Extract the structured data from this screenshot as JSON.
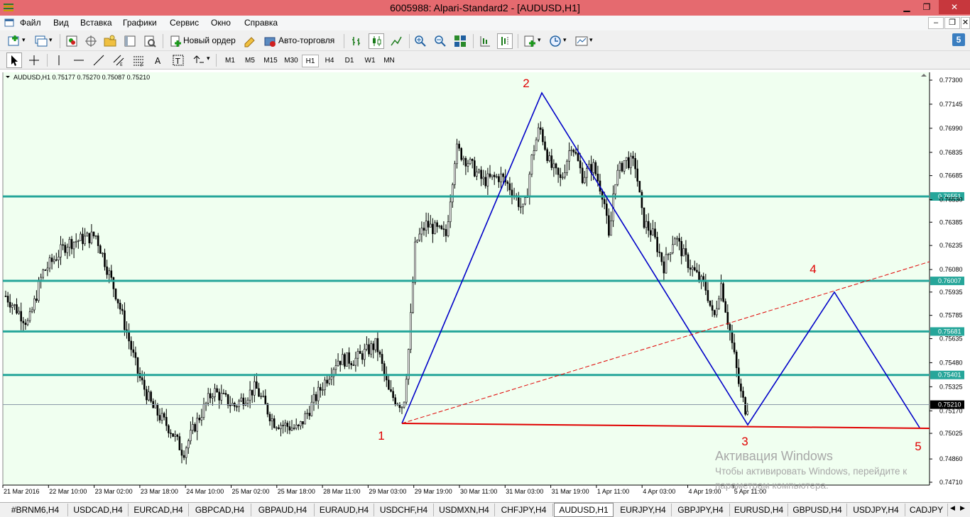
{
  "window": {
    "title": "6005988: Alpari-Standard2 - [AUDUSD,H1]",
    "minimize": "▁",
    "restore": "❐",
    "close": "✕"
  },
  "menu": {
    "items": [
      "Файл",
      "Вид",
      "Вставка",
      "Графики",
      "Сервис",
      "Окно",
      "Справка"
    ]
  },
  "toolbar": {
    "new_order": "Новый ордер",
    "auto_trading": "Авто-торговля"
  },
  "timeframes": [
    "M1",
    "M5",
    "M15",
    "M30",
    "H1",
    "H4",
    "D1",
    "W1",
    "MN"
  ],
  "active_timeframe": "H1",
  "chart": {
    "info": "AUDUSD,H1  0.75177 0.75270 0.75087 0.75210",
    "price_labels": [
      "0.77300",
      "0.77145",
      "0.76990",
      "0.76835",
      "0.76685",
      "0.76530",
      "0.76385",
      "0.76235",
      "0.76080",
      "0.75935",
      "0.75785",
      "0.75635",
      "0.75480",
      "0.75325",
      "0.75170",
      "0.75025",
      "0.74860",
      "0.74710"
    ],
    "level_labels": [
      "0.76551",
      "0.76007",
      "0.75681",
      "0.75401"
    ],
    "current_price": "0.75210",
    "time_labels": [
      "21 Mar 2016",
      "22 Mar 10:00",
      "23 Mar 02:00",
      "23 Mar 18:00",
      "24 Mar 10:00",
      "25 Mar 02:00",
      "25 Mar 18:00",
      "28 Mar 11:00",
      "29 Mar 03:00",
      "29 Mar 19:00",
      "30 Mar 11:00",
      "31 Mar 03:00",
      "31 Mar 19:00",
      "1 Apr 11:00",
      "4 Apr 03:00",
      "4 Apr 19:00",
      "5 Apr 11:00"
    ],
    "points": [
      "1",
      "2",
      "3",
      "4",
      "5"
    ],
    "colors": {
      "background": "#f0fff0",
      "levels": "#26a69a",
      "pattern": "#0000c8",
      "support": "#e00000",
      "labels": "#e00000",
      "candles": "#000000"
    }
  },
  "watermark": {
    "title": "Активация Windows",
    "line1": "Чтобы активировать Windows, перейдите к",
    "line2": "параметрам компьютера."
  },
  "tabs": [
    "#BRNM6,H4",
    "USDCAD,H4",
    "EURCAD,H4",
    "GBPCAD,H4",
    "GBPAUD,H4",
    "EURAUD,H4",
    "USDCHF,H4",
    "USDMXN,H4",
    "CHFJPY,H4",
    "AUDUSD,H1",
    "EURJPY,H4",
    "GBPJPY,H4",
    "EURUSD,H4",
    "GBPUSD,H4",
    "USDJPY,H4",
    "CADJPY"
  ],
  "active_tab": "AUDUSD,H1"
}
